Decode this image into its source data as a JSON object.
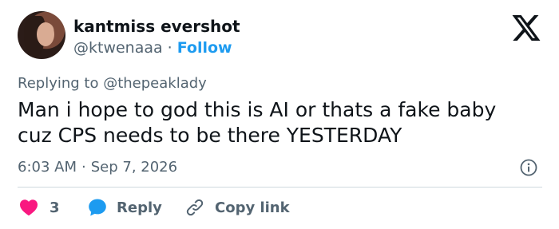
{
  "author": {
    "display_name": "kantmiss evershot",
    "handle": "@ktwenaaa",
    "separator": "·",
    "follow_label": "Follow"
  },
  "reply_context": {
    "prefix": "Replying to",
    "mention": "@thepeaklady"
  },
  "tweet": {
    "line1": "Man i hope to god this is AI or thats a fake baby",
    "line2": "cuz CPS needs to be there YESTERDAY",
    "time": "6:03 AM",
    "separator": "·",
    "date": "Sep 7, 2026"
  },
  "actions": {
    "like_count": "3",
    "reply_label": "Reply",
    "copy_label": "Copy link"
  },
  "colors": {
    "text": "#0f1419",
    "secondary": "#536471",
    "accent": "#1d9bf0",
    "like": "#f91880",
    "divider": "#cfd9de"
  },
  "icons": {
    "brand": "x-logo-icon",
    "info": "info-icon",
    "like": "heart-icon",
    "reply": "speech-bubble-icon",
    "copy": "link-icon"
  }
}
